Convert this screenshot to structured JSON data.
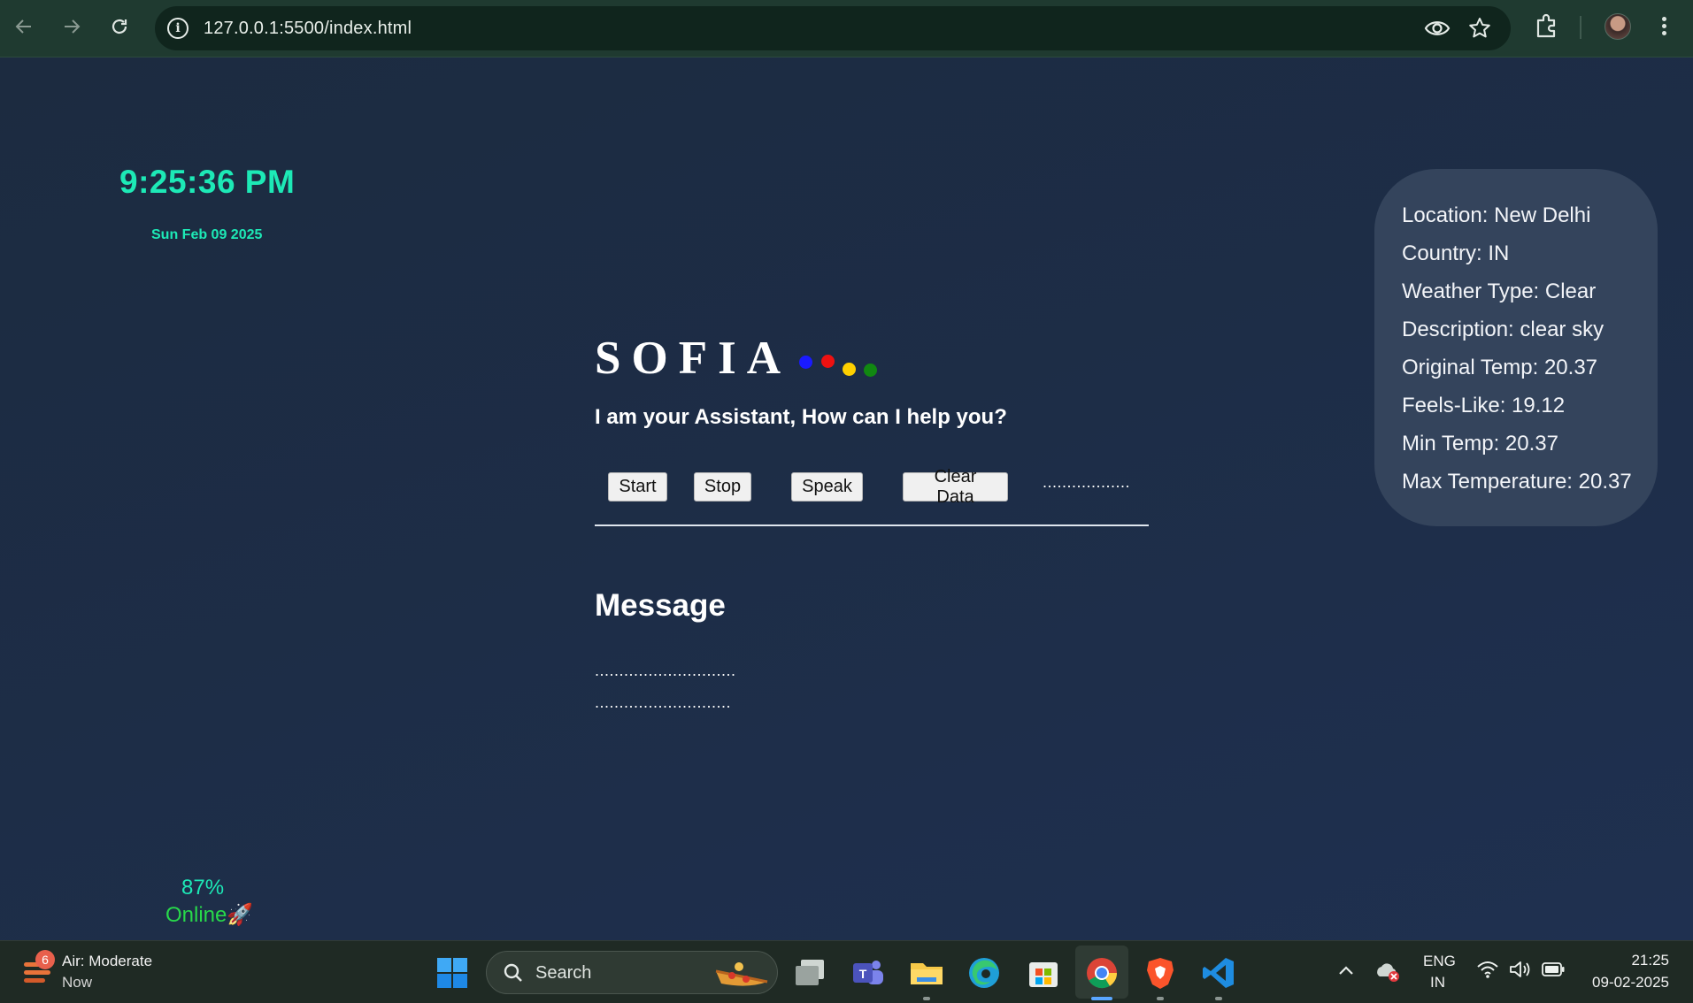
{
  "browser": {
    "url": "127.0.0.1:5500/index.html"
  },
  "page": {
    "clock_time": "9:25:36 PM",
    "clock_date": "Sun Feb 09 2025",
    "weather": {
      "location": "Location: New Delhi",
      "country": "Country: IN",
      "weather_type": "Weather Type: Clear",
      "description": "Description: clear sky",
      "original_temp": "Original Temp: 20.37",
      "feels_like": "Feels-Like: 19.12",
      "min_temp": "Min Temp: 20.37",
      "max_temp": "Max Temperature: 20.37"
    },
    "title": "SOFIA",
    "dot_colors": [
      "#1a1aff",
      "#ee1111",
      "#ffd000",
      "#118811"
    ],
    "subtitle": "I am your Assistant, How can I help you?",
    "buttons": {
      "start": "Start",
      "stop": "Stop",
      "speak": "Speak",
      "clear": "Clear Data"
    },
    "status_text": "..................",
    "message_heading": "Message",
    "message_line_1": ".............................",
    "message_line_2": "............................",
    "battery": "87%",
    "online": "Online🚀",
    "accent_color": "#1de9b6"
  },
  "taskbar": {
    "weather_badge": "6",
    "air_title": "Air: Moderate",
    "air_sub": "Now",
    "search_placeholder": "Search",
    "lang_top": "ENG",
    "lang_bottom": "IN",
    "time": "21:25",
    "date": "09-02-2025"
  }
}
